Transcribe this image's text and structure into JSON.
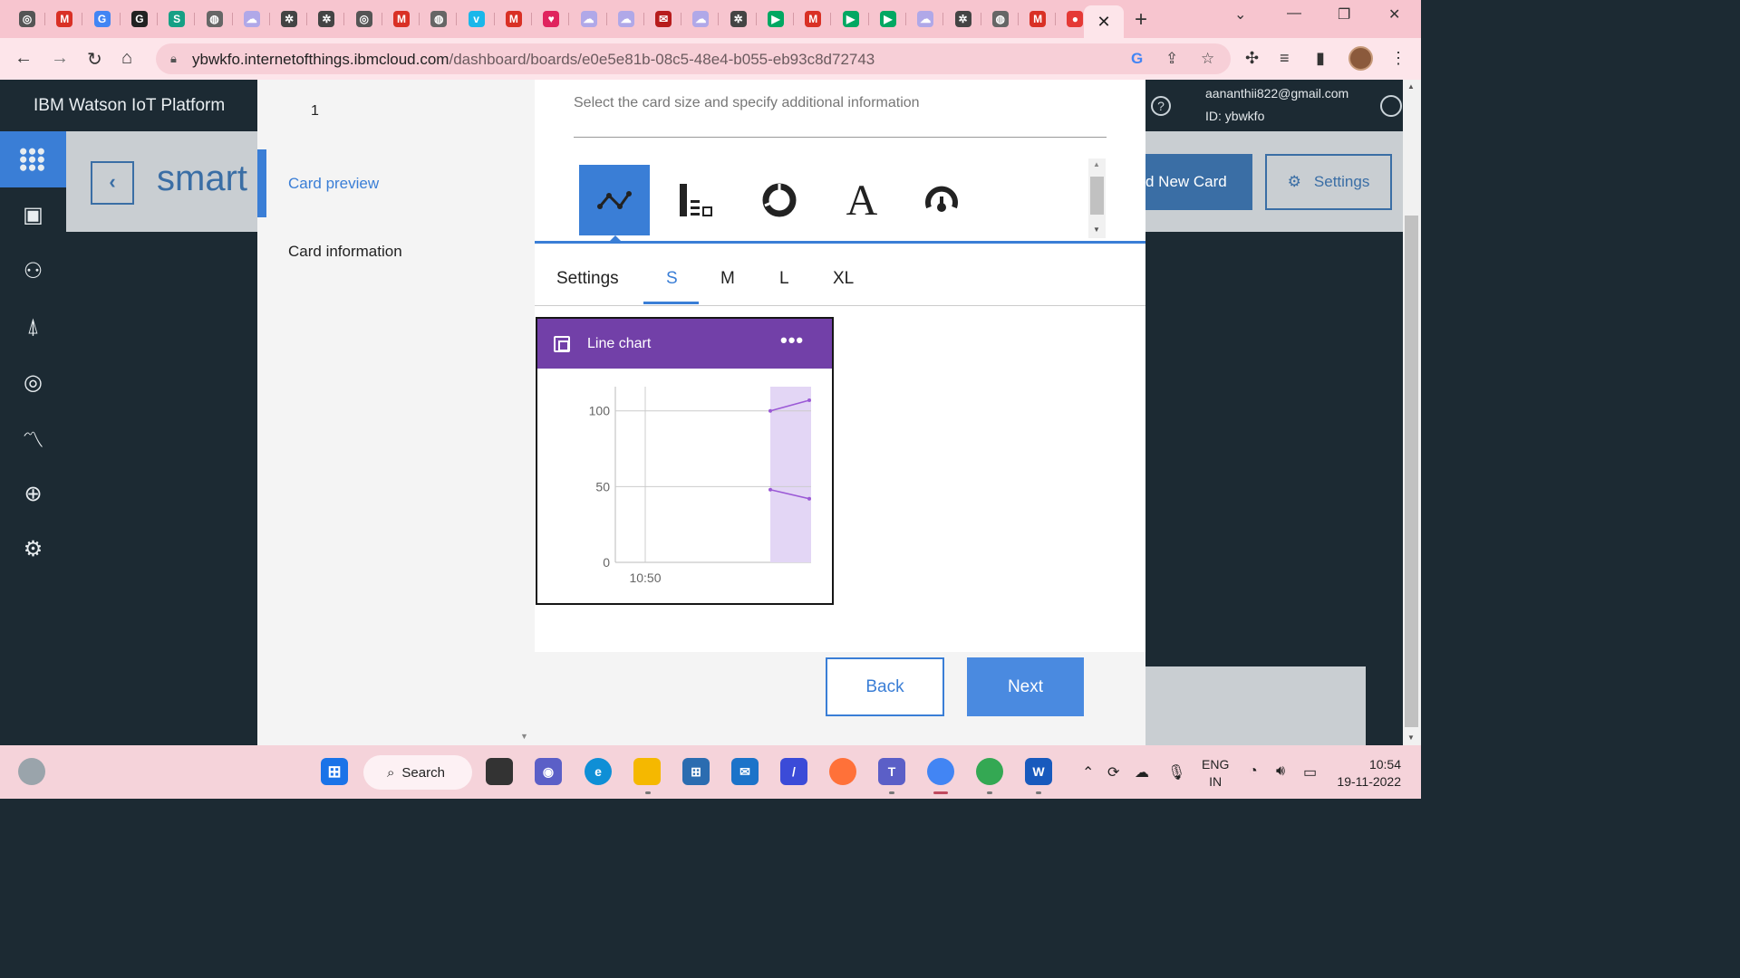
{
  "browser": {
    "tabs": [
      {
        "icon": "chrome-icon",
        "color": "#555555",
        "glyph": "◎"
      },
      {
        "icon": "gmail-icon",
        "color": "#d93025",
        "glyph": "M"
      },
      {
        "icon": "google-icon",
        "color": "#4285f4",
        "glyph": "G"
      },
      {
        "icon": "grammarly-icon",
        "color": "#222222",
        "glyph": "G"
      },
      {
        "icon": "s-icon",
        "color": "#16a085",
        "glyph": "S"
      },
      {
        "icon": "globe-icon",
        "color": "#666666",
        "glyph": "◍"
      },
      {
        "icon": "cloud-icon",
        "color": "#b0a8e8",
        "glyph": "☁"
      },
      {
        "icon": "bee-icon",
        "color": "#444444",
        "glyph": "✲"
      },
      {
        "icon": "bee-icon",
        "color": "#444444",
        "glyph": "✲"
      },
      {
        "icon": "chrome-icon",
        "color": "#555555",
        "glyph": "◎"
      },
      {
        "icon": "gmail-icon",
        "color": "#d93025",
        "glyph": "M"
      },
      {
        "icon": "globe-icon",
        "color": "#666666",
        "glyph": "◍"
      },
      {
        "icon": "vimeo-icon",
        "color": "#1ab7ea",
        "glyph": "v"
      },
      {
        "icon": "gmail-icon",
        "color": "#d93025",
        "glyph": "M"
      },
      {
        "icon": "heart-icon",
        "color": "#e0245e",
        "glyph": "♥"
      },
      {
        "icon": "cloud-icon",
        "color": "#b0a8e8",
        "glyph": "☁"
      },
      {
        "icon": "cloud-icon",
        "color": "#b0a8e8",
        "glyph": "☁"
      },
      {
        "icon": "mail-red-icon",
        "color": "#b71c1c",
        "glyph": "✉"
      },
      {
        "icon": "cloud-icon",
        "color": "#b0a8e8",
        "glyph": "☁"
      },
      {
        "icon": "bee-icon",
        "color": "#444444",
        "glyph": "✲"
      },
      {
        "icon": "meet-icon",
        "color": "#00a862",
        "glyph": "▶"
      },
      {
        "icon": "gmail-icon",
        "color": "#d93025",
        "glyph": "M"
      },
      {
        "icon": "meet-icon",
        "color": "#00a862",
        "glyph": "▶"
      },
      {
        "icon": "meet-icon",
        "color": "#00a862",
        "glyph": "▶"
      },
      {
        "icon": "cloud-icon",
        "color": "#b0a8e8",
        "glyph": "☁"
      },
      {
        "icon": "bee-icon",
        "color": "#444444",
        "glyph": "✲"
      },
      {
        "icon": "globe-icon",
        "color": "#666666",
        "glyph": "◍"
      },
      {
        "icon": "gmail-icon",
        "color": "#d93025",
        "glyph": "M"
      },
      {
        "icon": "record-icon",
        "color": "#e53935",
        "glyph": "●"
      }
    ],
    "active_tab_close": "✕",
    "new_tab": "+",
    "url_host": "ybwkfo.internetofthings.ibmcloud.com",
    "url_path": "/dashboard/boards/e0e5e81b-08c5-48e4-b055-eb93c8d72743"
  },
  "app": {
    "brand": "IBM Watson IoT Platform",
    "user_email": "aananthii822@gmail.com",
    "user_id": "ID: ybwkfo",
    "board_title": "smart",
    "add_card_label": "d New Card",
    "settings_label": "Settings",
    "nav_items": [
      {
        "name": "apps-grid",
        "glyph": "⋮⋮⋮",
        "active": true
      },
      {
        "name": "devices",
        "glyph": "▣",
        "active": false
      },
      {
        "name": "members",
        "glyph": "⚇",
        "active": false
      },
      {
        "name": "apps",
        "glyph": "⍋",
        "active": false
      },
      {
        "name": "security-fingerprint",
        "glyph": "◎",
        "active": false
      },
      {
        "name": "usage",
        "glyph": "〽",
        "active": false
      },
      {
        "name": "rules-lock",
        "glyph": "⊕",
        "active": false
      },
      {
        "name": "settings",
        "glyph": "⚙",
        "active": false
      }
    ]
  },
  "modal": {
    "step_number": "1",
    "steps": [
      "Card preview",
      "Card information"
    ],
    "subtitle": "Select the card size and specify additional information",
    "card_types": [
      "line-chart",
      "bar-chart",
      "donut-chart",
      "text",
      "gauge"
    ],
    "size_tabs": [
      "Settings",
      "S",
      "M",
      "L",
      "XL"
    ],
    "active_size": "S",
    "card_title": "Line chart",
    "card_more": "•••",
    "back_label": "Back",
    "next_label": "Next"
  },
  "chart_data": {
    "type": "line",
    "title": "Line chart",
    "x_tick_labels": [
      "10:50"
    ],
    "y_tick_labels": [
      "100",
      "50",
      "0"
    ],
    "ylim": [
      0,
      110
    ],
    "series": [
      {
        "values": [
          100,
          107
        ]
      },
      {
        "values": [
          48,
          42
        ]
      }
    ],
    "grid": true,
    "colors": {
      "line": "#9b59d6",
      "fill": "#e3d6f5"
    }
  },
  "taskbar": {
    "search_label": "Search",
    "lang_top": "ENG",
    "lang_bottom": "IN",
    "time": "10:54",
    "date": "19-11-2022"
  }
}
